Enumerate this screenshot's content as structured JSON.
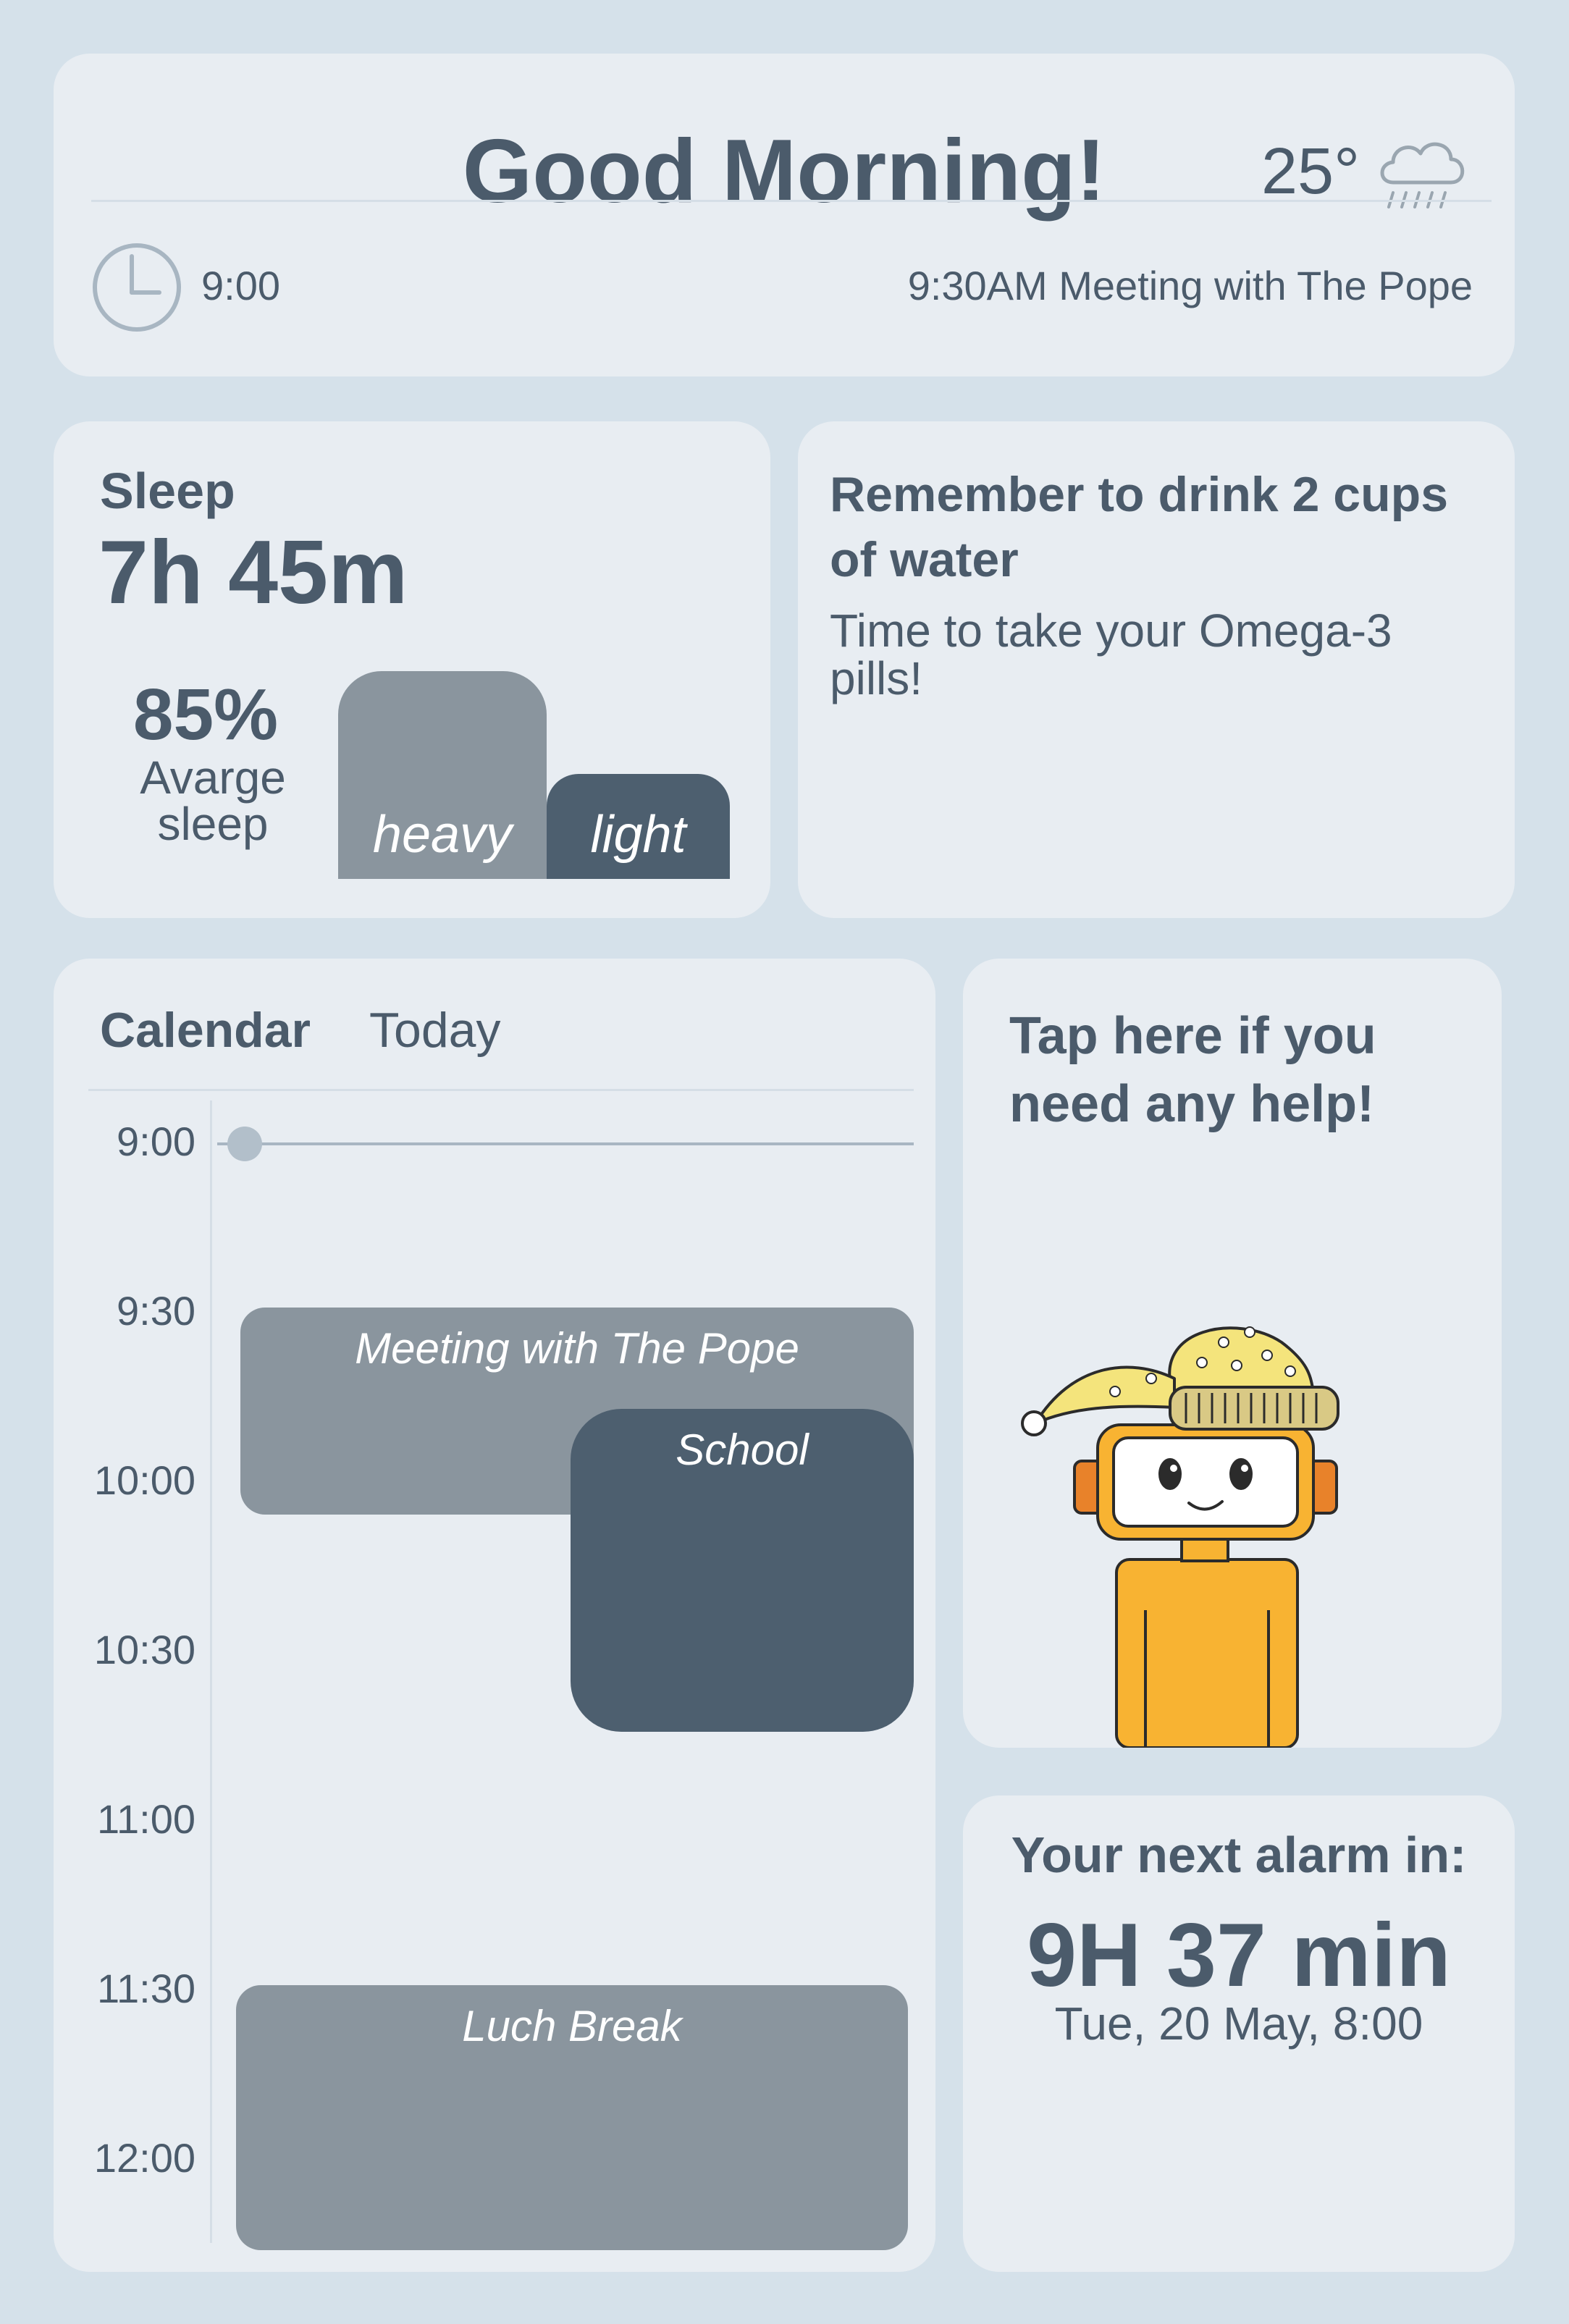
{
  "header": {
    "greeting": "Good Morning!",
    "temperature": "25°",
    "weather_icon": "rain-cloud-icon",
    "time": "9:00",
    "next_event": "9:30AM Meeting with The Pope"
  },
  "sleep": {
    "title": "Sleep",
    "duration": "7h 45m",
    "percent": "85%",
    "percent_label": "Avarge sleep",
    "bars": [
      {
        "label": "heavy",
        "color": "#8a959e"
      },
      {
        "label": "light",
        "color": "#4d5f6f"
      }
    ]
  },
  "reminder": {
    "title": "Remember to drink 2 cups of water",
    "text": "Time to take your Omega-3 pills!"
  },
  "calendar": {
    "title": "Calendar",
    "range": "Today",
    "time_labels": [
      "9:00",
      "9:30",
      "10:00",
      "10:30",
      "11:00",
      "11:30",
      "12:00"
    ],
    "events": [
      {
        "title": "Meeting with The Pope",
        "color": "#8a959e"
      },
      {
        "title": "School",
        "color": "#4d5f6f"
      },
      {
        "title": "Luch Break",
        "color": "#8a959e"
      }
    ]
  },
  "help": {
    "text": "Tap here if you need any help!",
    "illustration": "robot-with-nightcap"
  },
  "alarm": {
    "title": "Your next alarm in:",
    "countdown": "9H 37 min",
    "date": "Tue, 20 May, 8:00"
  },
  "colors": {
    "background": "#d5e1ea",
    "card": "#e8edf2",
    "text": "#4b5b6b",
    "accent_dark": "#4d5f6f",
    "accent_gray": "#8a959e"
  }
}
